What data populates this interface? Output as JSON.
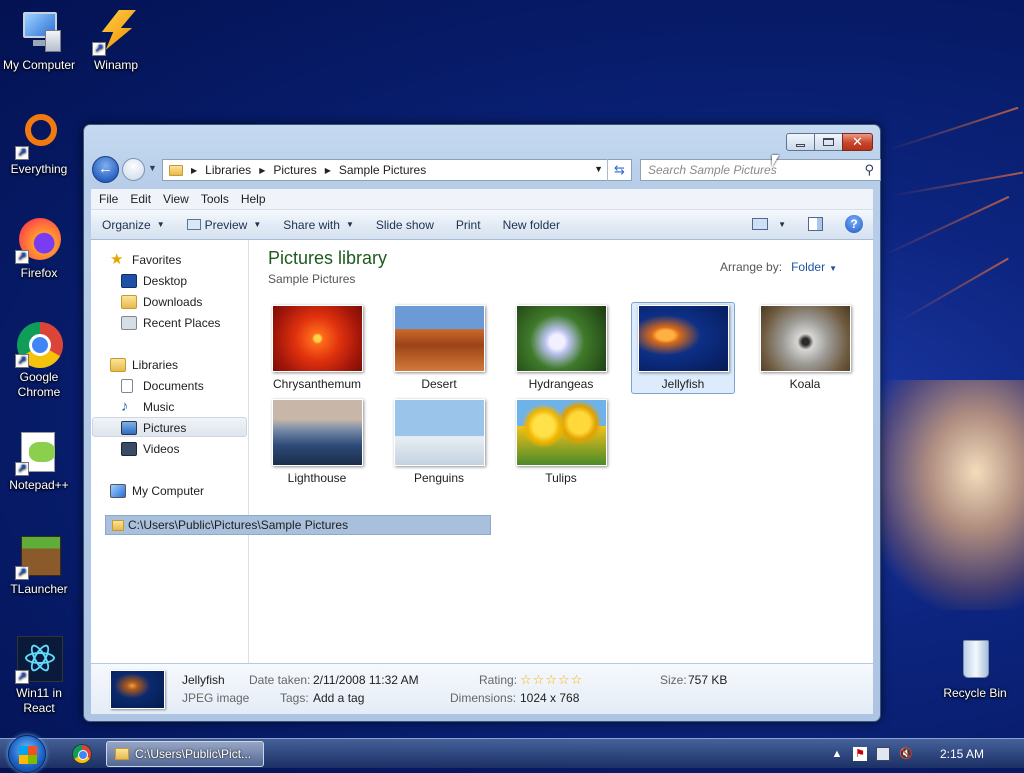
{
  "desktop": {
    "icons": [
      {
        "label": "My Computer",
        "icon": "computer-icon"
      },
      {
        "label": "Winamp",
        "icon": "winamp-icon"
      },
      {
        "label": "Everything",
        "icon": "everything-icon"
      },
      {
        "label": "Firefox",
        "icon": "firefox-icon"
      },
      {
        "label": "Google Chrome",
        "icon": "chrome-icon"
      },
      {
        "label": "Notepad++",
        "icon": "notepadpp-icon"
      },
      {
        "label": "TLauncher",
        "icon": "tlauncher-icon"
      },
      {
        "label": "Win11 in React",
        "icon": "react-icon"
      },
      {
        "label": "Recycle Bin",
        "icon": "recycle-bin-icon"
      }
    ]
  },
  "window": {
    "breadcrumbs": [
      "Libraries",
      "Pictures",
      "Sample Pictures"
    ],
    "search_placeholder": "Search Sample Pictures",
    "menu": [
      "File",
      "Edit",
      "View",
      "Tools",
      "Help"
    ],
    "toolbar": {
      "organize": "Organize",
      "preview": "Preview",
      "share_with": "Share with",
      "slide_show": "Slide show",
      "print": "Print",
      "new_folder": "New folder"
    },
    "nav": {
      "favorites": "Favorites",
      "desktop": "Desktop",
      "downloads": "Downloads",
      "recent_places": "Recent Places",
      "libraries": "Libraries",
      "documents": "Documents",
      "music": "Music",
      "pictures": "Pictures",
      "videos": "Videos",
      "my_computer": "My Computer"
    },
    "library_title": "Pictures library",
    "library_subtitle": "Sample Pictures",
    "arrange_label": "Arrange by:",
    "arrange_value": "Folder",
    "files": [
      {
        "name": "Chrysanthemum"
      },
      {
        "name": "Desert"
      },
      {
        "name": "Hydrangeas"
      },
      {
        "name": "Jellyfish",
        "selected": true
      },
      {
        "name": "Koala"
      },
      {
        "name": "Lighthouse"
      },
      {
        "name": "Penguins"
      },
      {
        "name": "Tulips"
      }
    ],
    "path_tooltip": "C:\\Users\\Public\\Pictures\\Sample Pictures",
    "details": {
      "name": "Jellyfish",
      "type": "JPEG image",
      "date_label": "Date taken:",
      "date_value": "2/11/2008 11:32 AM",
      "tags_label": "Tags:",
      "tags_value": "Add a tag",
      "rating_label": "Rating:",
      "rating_stars": 5,
      "dimensions_label": "Dimensions:",
      "dimensions_value": "1024 x 768",
      "size_label": "Size:",
      "size_value": "757 KB"
    }
  },
  "taskbar": {
    "task_label": "C:\\Users\\Public\\Pict...",
    "clock": "2:15 AM"
  }
}
